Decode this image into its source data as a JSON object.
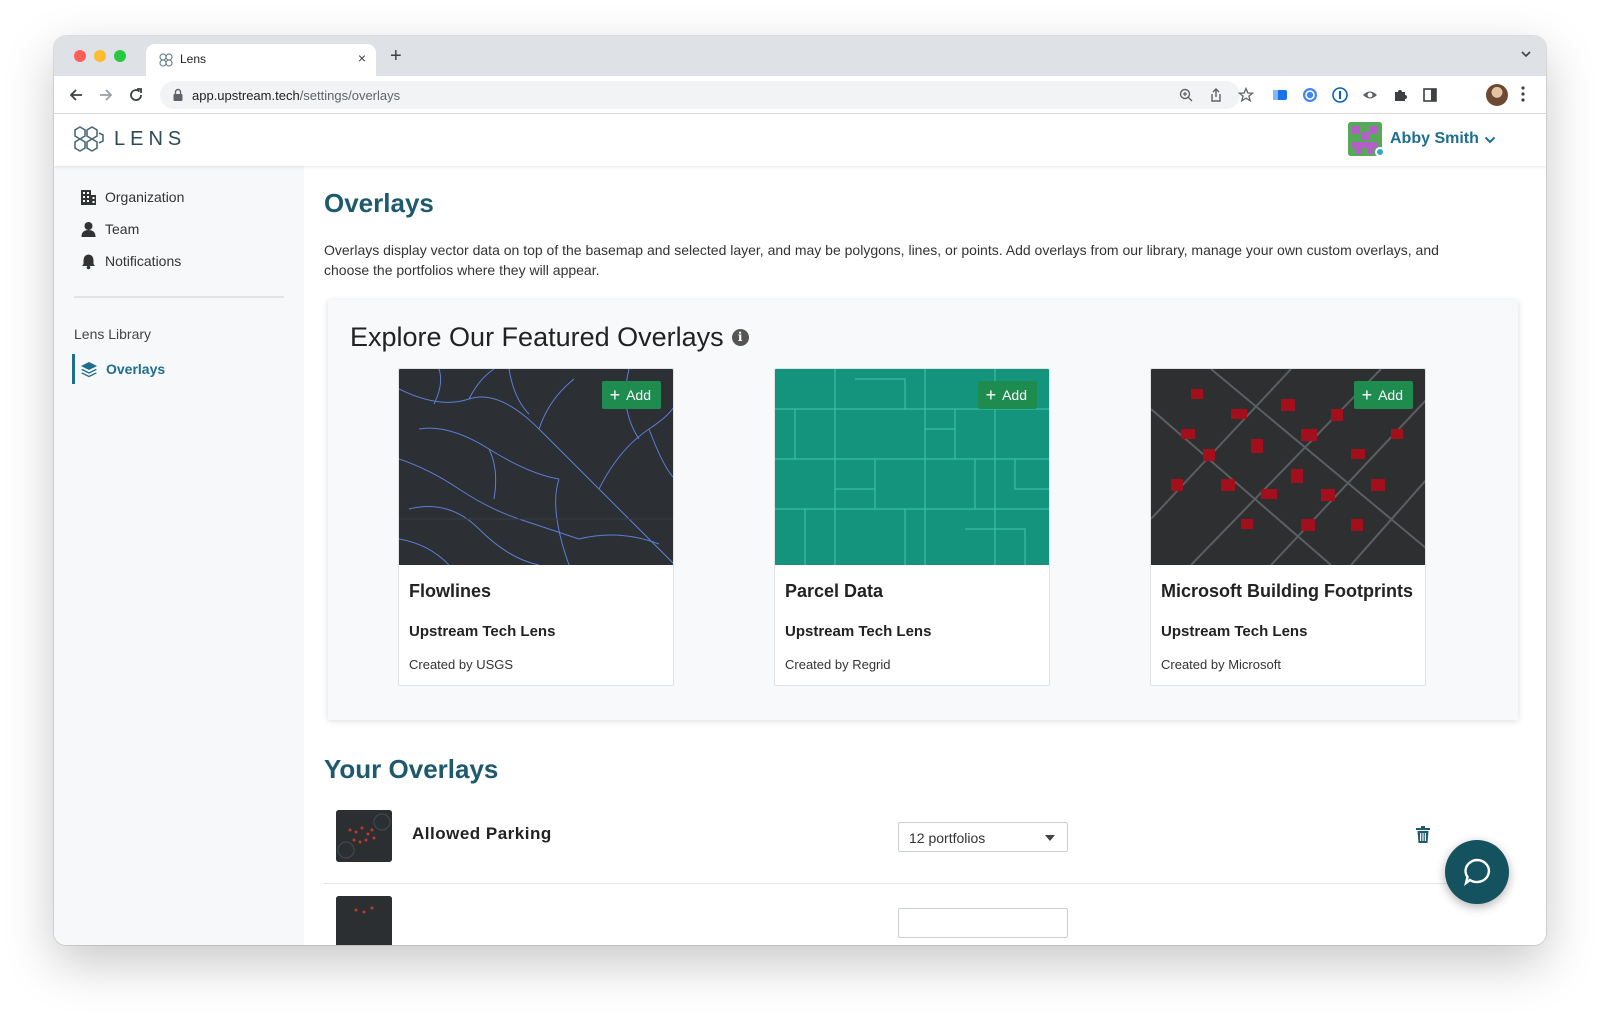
{
  "browser": {
    "tab_title": "Lens",
    "tab_close": "×",
    "new_tab": "+",
    "url_host": "app.upstream.tech",
    "url_path": "/settings/overlays"
  },
  "app": {
    "brand": "LENS",
    "user_name": "Abby Smith"
  },
  "sidebar": {
    "items": [
      {
        "label": "Organization",
        "icon": "building-icon"
      },
      {
        "label": "Team",
        "icon": "person-icon"
      },
      {
        "label": "Notifications",
        "icon": "bell-icon"
      }
    ],
    "section_label": "Lens Library",
    "active_item": {
      "label": "Overlays",
      "icon": "layers-icon"
    }
  },
  "main": {
    "title": "Overlays",
    "description": "Overlays display vector data on top of the basemap and selected layer, and may be polygons, lines, or points. Add overlays from our library, manage your own custom overlays, and choose the portfolios where they will appear.",
    "featured": {
      "title": "Explore Our Featured Overlays",
      "info_glyph": "i",
      "cards": [
        {
          "title": "Flowlines",
          "org": "Upstream Tech Lens",
          "creator": "Created by USGS",
          "add_label": "Add",
          "thumb_color": "#2c2f33",
          "line_color": "#5b7fd6"
        },
        {
          "title": "Parcel Data",
          "org": "Upstream Tech Lens",
          "creator": "Created by Regrid",
          "add_label": "Add",
          "thumb_color": "#14947d",
          "line_color": "#3fc7ad"
        },
        {
          "title": "Microsoft Building Footprints",
          "org": "Upstream Tech Lens",
          "creator": "Created by Microsoft",
          "add_label": "Add",
          "thumb_color": "#2d2f31",
          "line_color": "#a3101c"
        }
      ]
    },
    "your_overlays": {
      "title": "Your Overlays",
      "rows": [
        {
          "name": "Allowed Parking",
          "portfolios": "12 portfolios"
        }
      ]
    }
  },
  "colors": {
    "accent": "#1d6e8f",
    "heading": "#1d5a6e",
    "add_green": "#1e8c4e",
    "chat_fab": "#15525f"
  }
}
